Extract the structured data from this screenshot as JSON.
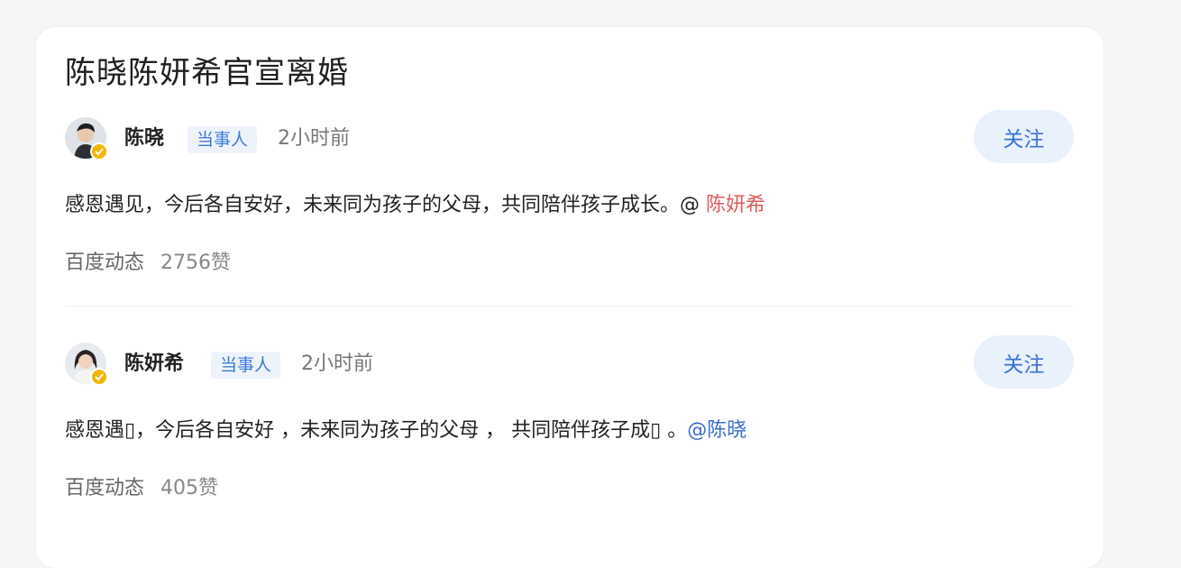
{
  "card": {
    "title": "陈晓陈妍希官宣离婚"
  },
  "posts": [
    {
      "name": "陈晓",
      "badge": "当事人",
      "time": "2小时前",
      "follow_label": "关注",
      "content_text": "感恩遇见，今后各自安好，未来同为孩子的父母，共同陪伴孩子成长。@ ",
      "mention": "陈妍希",
      "source": "百度动态",
      "likes": "2756赞"
    },
    {
      "name": "陈妍希",
      "badge": "当事人",
      "time": "2小时前",
      "follow_label": "关注",
      "content_text": "感恩遇▯，今后各自安好 ，未来同为孩子的父母 ， 共同陪伴孩子成▯ 。",
      "mention": "@陈晓",
      "source": "百度动态",
      "likes": "405赞"
    }
  ],
  "colors": {
    "accent": "#3a73d6",
    "mention_red": "#e05a5a",
    "verified": "#f2b600"
  }
}
